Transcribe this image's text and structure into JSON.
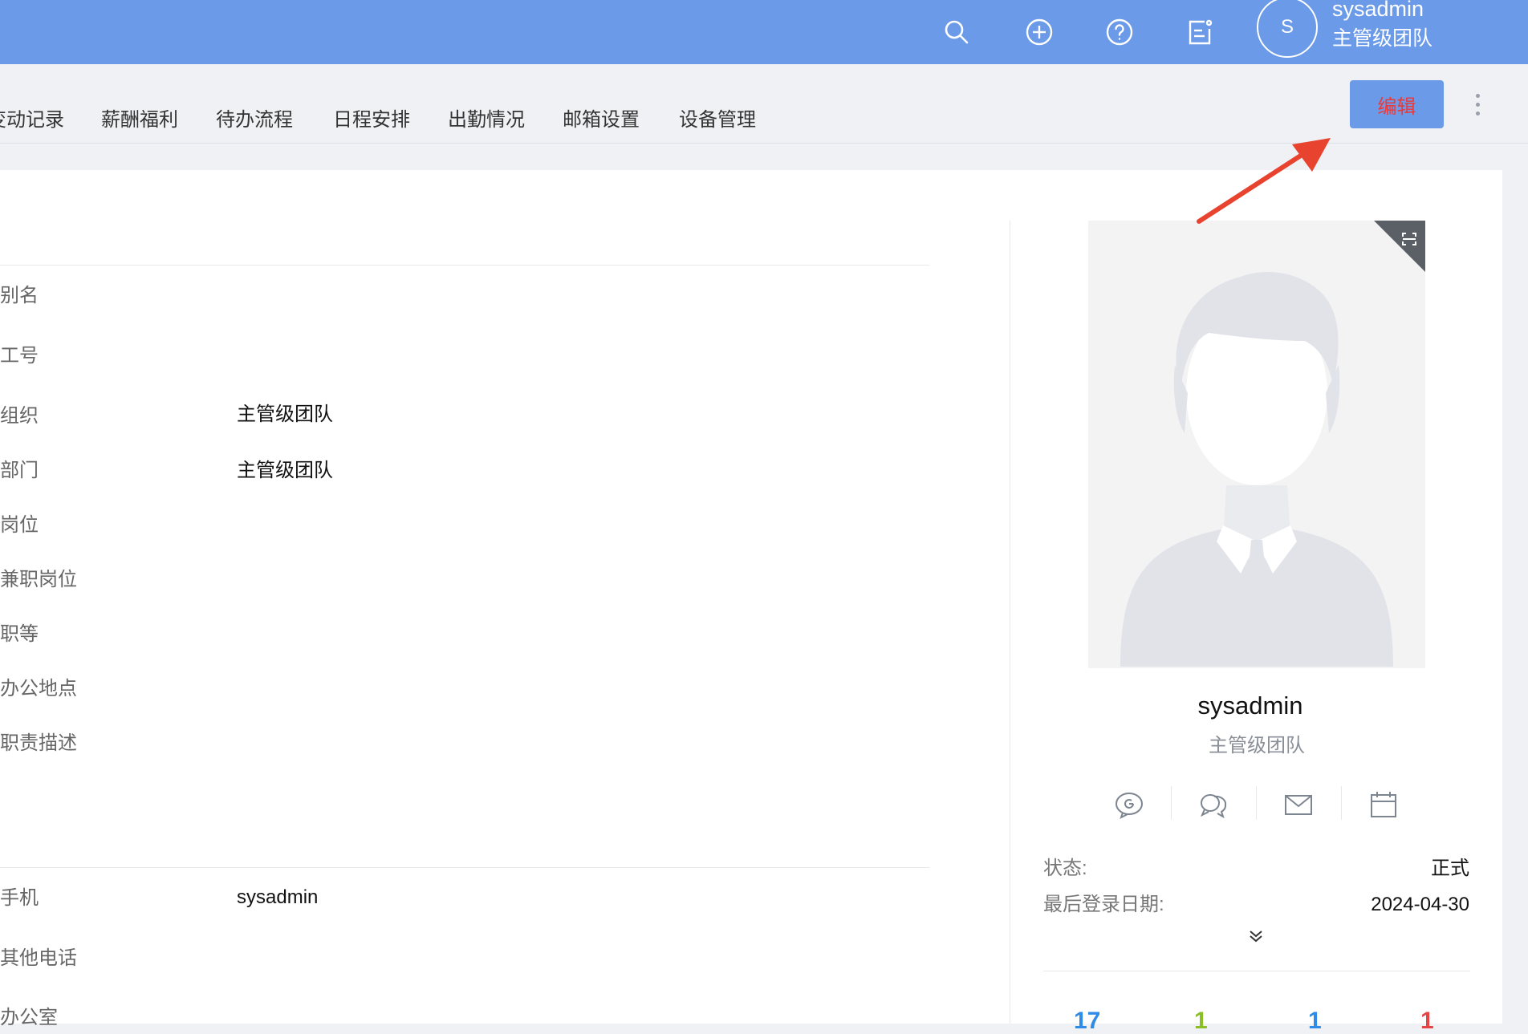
{
  "header": {
    "icons": [
      "search-icon",
      "add-circle-icon",
      "help-icon",
      "notes-icon"
    ],
    "avatar_initial": "S",
    "user_name": "sysadmin",
    "user_team": "主管级团队"
  },
  "tabs": [
    {
      "label": "变动记录"
    },
    {
      "label": "薪酬福利"
    },
    {
      "label": "待办流程"
    },
    {
      "label": "日程安排"
    },
    {
      "label": "出勤情况"
    },
    {
      "label": "邮箱设置"
    },
    {
      "label": "设备管理"
    }
  ],
  "toolbar": {
    "edit_label": "编辑"
  },
  "fields": [
    {
      "label": "别名",
      "value": ""
    },
    {
      "label": "工号",
      "value": ""
    },
    {
      "label": "组织",
      "value": "主管级团队"
    },
    {
      "label": "部门",
      "value": "主管级团队"
    },
    {
      "label": "岗位",
      "value": ""
    },
    {
      "label": "兼职岗位",
      "value": ""
    },
    {
      "label": "职等",
      "value": ""
    },
    {
      "label": "办公地点",
      "value": ""
    },
    {
      "label": "职责描述",
      "value": ""
    }
  ],
  "contact_fields": [
    {
      "label": "手机",
      "value": "sysadmin"
    },
    {
      "label": "其他电话",
      "value": ""
    },
    {
      "label": "办公室",
      "value": ""
    }
  ],
  "profile": {
    "name": "sysadmin",
    "team": "主管级团队",
    "actions": [
      "chat-icon",
      "discussion-icon",
      "mail-icon",
      "calendar-icon"
    ],
    "status_label": "状态:",
    "status_value": "正式",
    "last_login_label": "最后登录日期:",
    "last_login_value": "2024-04-30"
  },
  "stats": [
    {
      "value": "17",
      "color": "#2f8be6"
    },
    {
      "value": "1",
      "color": "#8cbf26"
    },
    {
      "value": "1",
      "color": "#2f8be6"
    },
    {
      "value": "1",
      "color": "#e64545"
    }
  ],
  "colors": {
    "header_bg": "#6b9ae8",
    "edit_text": "#ea3a3a",
    "annotation_arrow": "#e8432e"
  }
}
